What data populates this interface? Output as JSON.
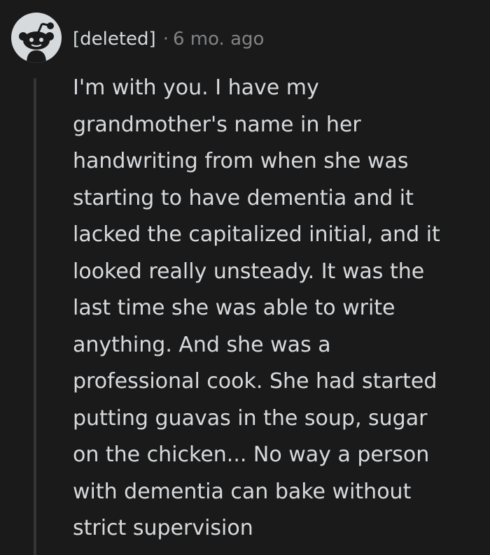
{
  "comment": {
    "author": "[deleted]",
    "separator": "·",
    "time": "6 mo. ago",
    "avatar_icon": "reddit-snoo-icon",
    "body": "I'm with you. I have my\ngrandmother's name in her\nhandwriting from when she was\nstarting to have dementia and it\nlacked the capitalized initial, and it\nlooked really unsteady. It was the\nlast time she was able to write\nanything. And she was a\nprofessional cook. She had started\nputting guavas in the soup, sugar\non the chicken... No way a person\nwith dementia can bake without\nstrict supervision"
  },
  "colors": {
    "background": "#1a1a1b",
    "text": "#d7dadc",
    "meta": "#818384",
    "thread_line": "#343536",
    "avatar_bg": "#d7dadc"
  }
}
